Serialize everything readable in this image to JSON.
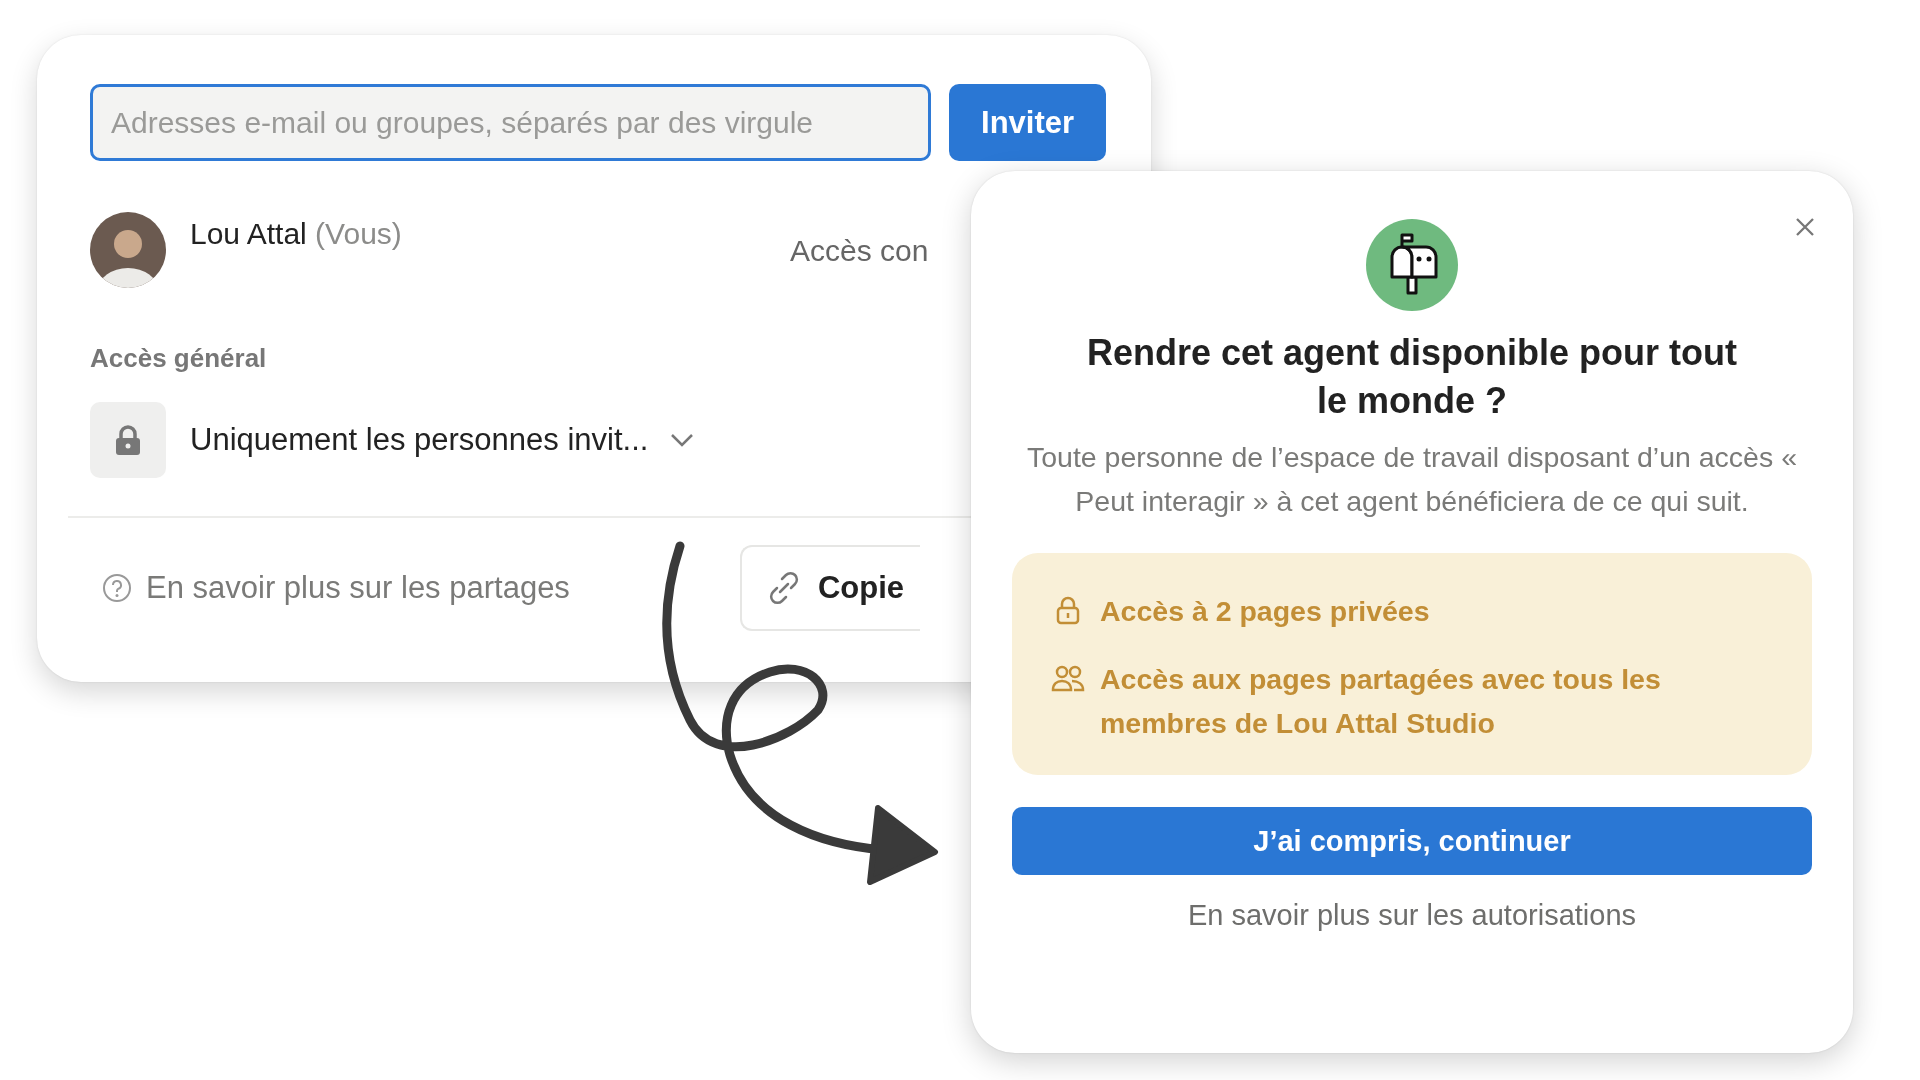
{
  "share_panel": {
    "invite_field": {
      "placeholder": "Adresses e-mail ou groupes, séparés par des virgule"
    },
    "invite_button": "Inviter",
    "member": {
      "name": "Lou Attal",
      "tag": "(Vous)",
      "access": "Accès con"
    },
    "general_access": {
      "heading": "Accès général",
      "option": "Uniquement les personnes invit..."
    },
    "help_link": "En savoir plus sur les partages",
    "copy_button": "Copie"
  },
  "dialog": {
    "title": "Rendre cet agent disponible pour tout le monde ?",
    "description": "Toute personne de l’espace de travail disposant d’un accès « Peut interagir » à cet agent bénéficiera de ce qui suit.",
    "notices": [
      {
        "kind": "lock",
        "text": "Accès à 2 pages privées"
      },
      {
        "kind": "people",
        "text": "Accès aux pages partagées avec tous les membres de Lou Attal Studio"
      }
    ],
    "confirm_button": "J’ai compris, continuer",
    "learn_more_link": "En savoir plus sur les autorisations"
  }
}
